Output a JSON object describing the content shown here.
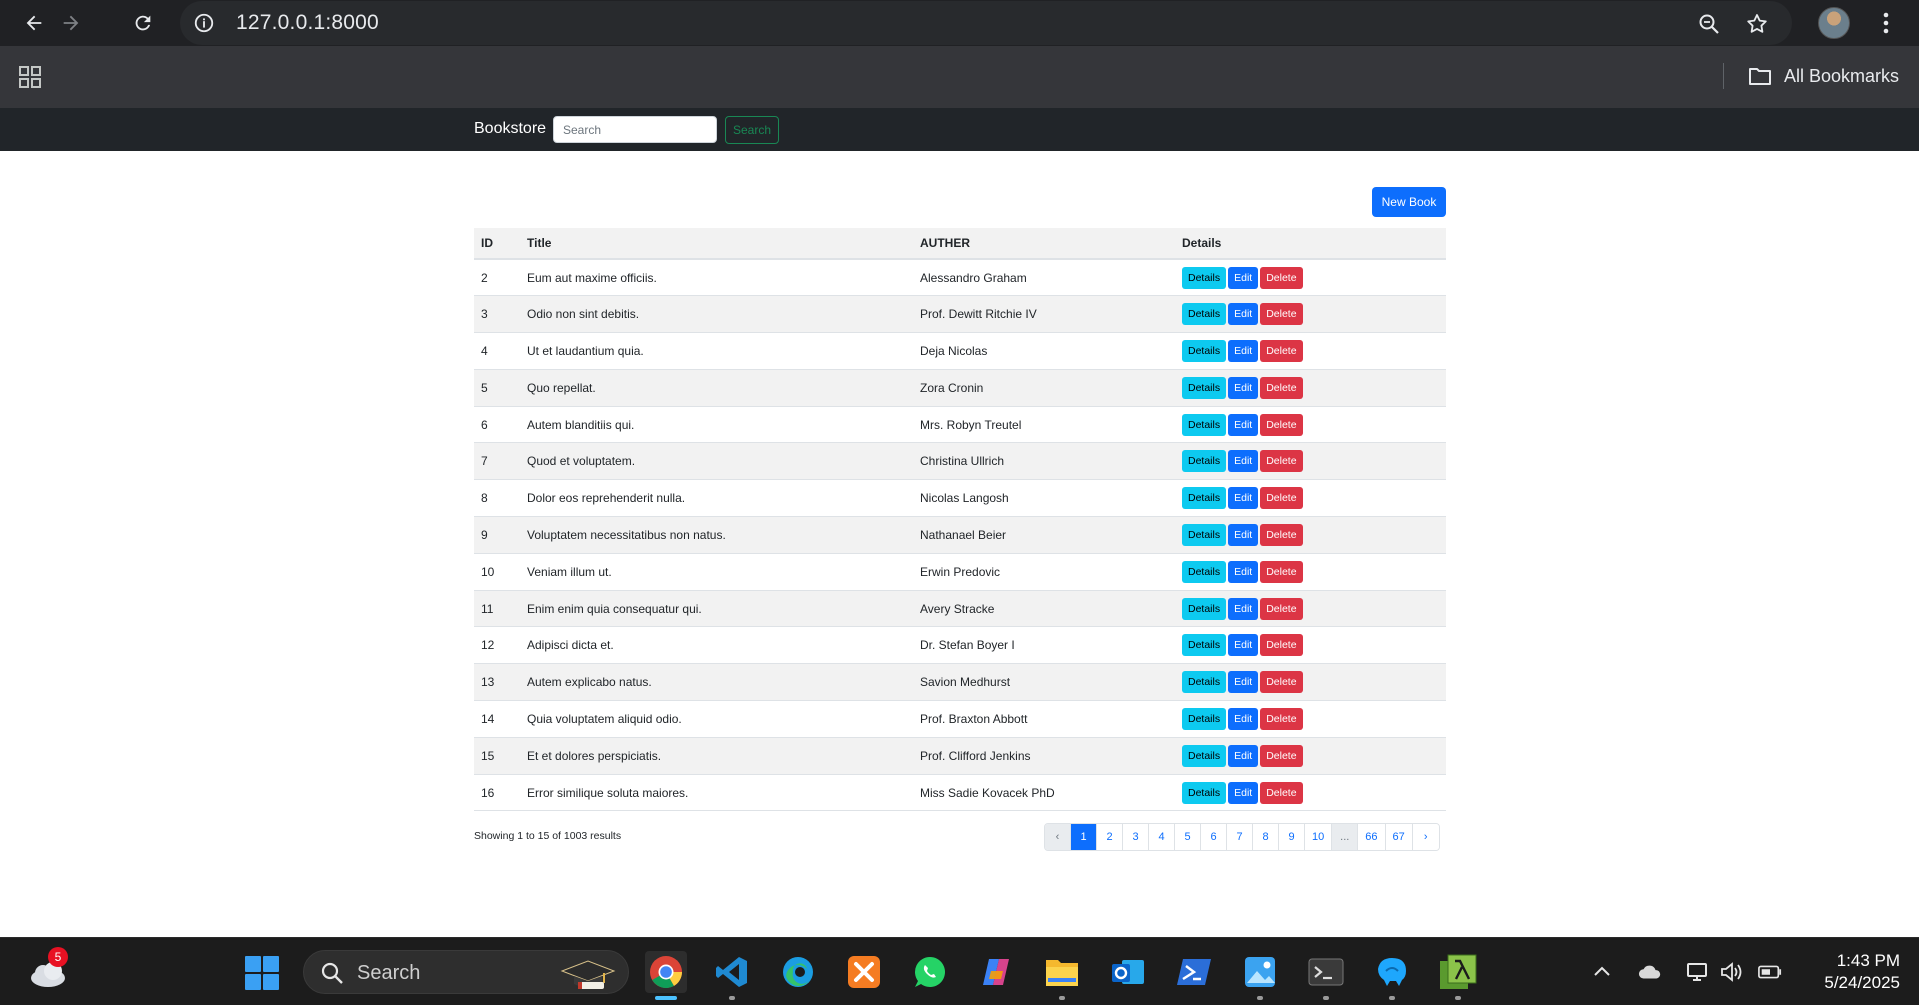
{
  "browser": {
    "url": "127.0.0.1:8000",
    "bookmarks_label": "All Bookmarks"
  },
  "navbar": {
    "brand": "Bookstore",
    "search_placeholder": "Search",
    "search_button": "Search"
  },
  "toolbar": {
    "new_book_label": "New Book"
  },
  "table": {
    "headers": [
      "ID",
      "Title",
      "AUTHER",
      "Details"
    ],
    "action_labels": {
      "details": "Details",
      "edit": "Edit",
      "delete": "Delete"
    },
    "rows": [
      {
        "id": "2",
        "title": "Eum aut maxime officiis.",
        "author": "Alessandro Graham"
      },
      {
        "id": "3",
        "title": "Odio non sint debitis.",
        "author": "Prof. Dewitt Ritchie IV"
      },
      {
        "id": "4",
        "title": "Ut et laudantium quia.",
        "author": "Deja Nicolas"
      },
      {
        "id": "5",
        "title": "Quo repellat.",
        "author": "Zora Cronin"
      },
      {
        "id": "6",
        "title": "Autem blanditiis qui.",
        "author": "Mrs. Robyn Treutel"
      },
      {
        "id": "7",
        "title": "Quod et voluptatem.",
        "author": "Christina Ullrich"
      },
      {
        "id": "8",
        "title": "Dolor eos reprehenderit nulla.",
        "author": "Nicolas Langosh"
      },
      {
        "id": "9",
        "title": "Voluptatem necessitatibus non natus.",
        "author": "Nathanael Beier"
      },
      {
        "id": "10",
        "title": "Veniam illum ut.",
        "author": "Erwin Predovic"
      },
      {
        "id": "11",
        "title": "Enim enim quia consequatur qui.",
        "author": "Avery Stracke"
      },
      {
        "id": "12",
        "title": "Adipisci dicta et.",
        "author": "Dr. Stefan Boyer I"
      },
      {
        "id": "13",
        "title": "Autem explicabo natus.",
        "author": "Savion Medhurst"
      },
      {
        "id": "14",
        "title": "Quia voluptatem aliquid odio.",
        "author": "Prof. Braxton Abbott"
      },
      {
        "id": "15",
        "title": "Et et dolores perspiciatis.",
        "author": "Prof. Clifford Jenkins"
      },
      {
        "id": "16",
        "title": "Error similique soluta maiores.",
        "author": "Miss Sadie Kovacek PhD"
      }
    ]
  },
  "pagination": {
    "summary": "Showing 1 to 15 of 1003 results",
    "items": [
      {
        "label": "‹",
        "state": "disabled",
        "name": "page-prev"
      },
      {
        "label": "1",
        "state": "active",
        "name": "page-1"
      },
      {
        "label": "2",
        "state": "",
        "name": "page-2"
      },
      {
        "label": "3",
        "state": "",
        "name": "page-3"
      },
      {
        "label": "4",
        "state": "",
        "name": "page-4"
      },
      {
        "label": "5",
        "state": "",
        "name": "page-5"
      },
      {
        "label": "6",
        "state": "",
        "name": "page-6"
      },
      {
        "label": "7",
        "state": "",
        "name": "page-7"
      },
      {
        "label": "8",
        "state": "",
        "name": "page-8"
      },
      {
        "label": "9",
        "state": "",
        "name": "page-9"
      },
      {
        "label": "10",
        "state": "",
        "name": "page-10"
      },
      {
        "label": "...",
        "state": "disabled",
        "name": "page-ellipsis"
      },
      {
        "label": "66",
        "state": "",
        "name": "page-66"
      },
      {
        "label": "67",
        "state": "",
        "name": "page-67"
      },
      {
        "label": "›",
        "state": "",
        "name": "page-next"
      }
    ]
  },
  "taskbar": {
    "search_label": "Search",
    "weather_badge": "5",
    "time": "1:43 PM",
    "date": "5/24/2025",
    "apps": [
      "chrome-icon",
      "vscode-icon",
      "edge-icon",
      "xampp-icon",
      "whatsapp-icon",
      "copilot-icon",
      "file-explorer-icon",
      "outlook-icon",
      "powershell-icon",
      "photos-icon",
      "terminal-icon",
      "mysql-workbench-icon",
      "lambda-app-icon"
    ]
  },
  "colors": {
    "primary": "#0d6efd",
    "info": "#0dcaf0",
    "danger": "#dc3545",
    "success": "#198754",
    "navbar": "#212529"
  }
}
